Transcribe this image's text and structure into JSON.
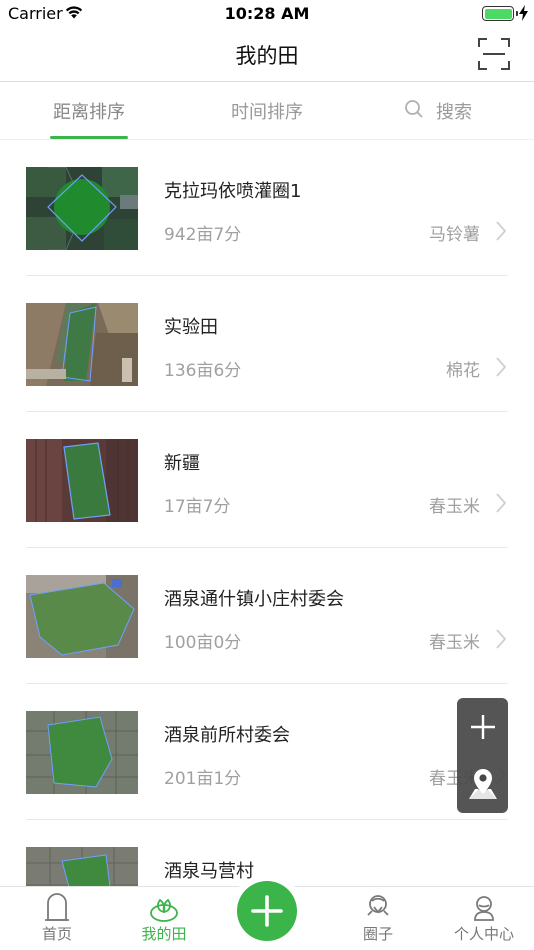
{
  "status_bar": {
    "carrier": "Carrier",
    "time": "10:28 AM",
    "battery_level": 1.0
  },
  "nav": {
    "title": "我的田",
    "scan_icon": "scan-frame-icon"
  },
  "tabs": {
    "distance_label": "距离排序",
    "time_label": "时间排序",
    "search_label": "搜索",
    "active": "distance"
  },
  "fields": [
    {
      "name": "克拉玛依喷灌圈1",
      "area": "942亩7分",
      "crop": "马铃薯"
    },
    {
      "name": "实验田",
      "area": "136亩6分",
      "crop": "棉花"
    },
    {
      "name": "新疆",
      "area": "17亩7分",
      "crop": "春玉米"
    },
    {
      "name": "酒泉通什镇小庄村委会",
      "area": "100亩0分",
      "crop": "春玉米"
    },
    {
      "name": "酒泉前所村委会",
      "area": "201亩1分",
      "crop": "春玉米"
    },
    {
      "name": "酒泉马营村",
      "area": "",
      "crop": ""
    }
  ],
  "float_actions": {
    "add_icon": "plus-icon",
    "locate_icon": "map-pin-icon"
  },
  "tab_bar": {
    "home_label": "首页",
    "myfield_label": "我的田",
    "circle_label": "圈子",
    "profile_label": "个人中心",
    "active": "myfield"
  },
  "colors": {
    "accent": "#3bb54a",
    "muted_text": "#a0a0a0",
    "float_bg": "#464646"
  }
}
